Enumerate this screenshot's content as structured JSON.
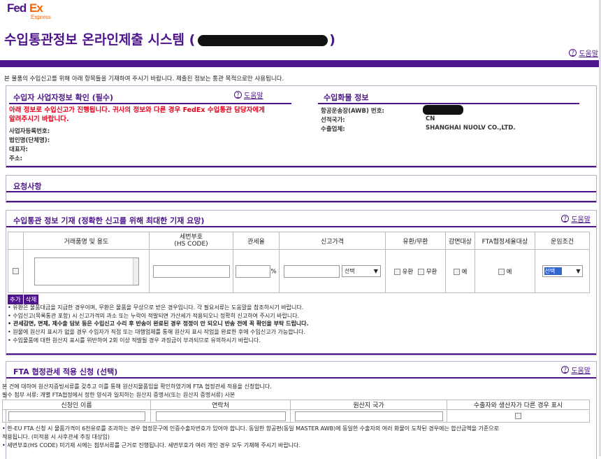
{
  "logo": {
    "fed": "Fed",
    "ex": "Ex",
    "express": "Express"
  },
  "title": {
    "main": "수입통관정보 온라인제출 시스템 (",
    "close": ")"
  },
  "help_label": "도움말",
  "intro": "본 물품의 수입신고를 위해 아래 항목들을 기재하여 주시기 바랍니다. 제출된 정보는 통관 목적으로만 사용됩니다.",
  "importer": {
    "title": "수입자 사업자정보 확인 (필수)",
    "warning": "아래 정보로 수입신고가 진행됩니다. 귀사의 정보와 다른 경우 FedEx 수입통관 담당자에게 알려주시기 바랍니다.",
    "fields": [
      "사업자등록번호:",
      "법인명(단체명):",
      "대표자:",
      "주소:"
    ]
  },
  "cargo": {
    "title": "수입화물 정보",
    "fields": [
      {
        "label": "항공운송장(AWB) 번호:",
        "value": ""
      },
      {
        "label": "선적국가:",
        "value": "CN"
      },
      {
        "label": "수출업체:",
        "value": "SHANGHAI NUOLV CO.,LTD."
      }
    ]
  },
  "requests": {
    "title": "요청사항"
  },
  "customs": {
    "title": "수입통관 정보 기재 (정확한 신고를 위해 최대한 기재 요망)",
    "headers": [
      "거래품명 및 용도",
      "세번부호\n(HS CODE)",
      "관세율",
      "신고가격",
      "유환/무환",
      "감면대상",
      "FTA협정세율대상",
      "운임조건"
    ],
    "percent": "%",
    "price_select": "선택",
    "paid_label": "유환",
    "free_label": "무환",
    "yes_label": "예",
    "freight_select": "선택",
    "add_label": "추가",
    "delete_label": "삭제",
    "notes": [
      "• 유환은 물품대금을 지급한 경우이며, 무환은 물품을 무상으로 받은 경우입니다. 각 필요서류는 도움말을 참조하시기 바랍니다.",
      "• 수입신고(목록통관 포함) 시 신고가격의 과소 또는 누락이 적발되면 가산세가 적용되오니 정확히 신고하여 주시기 바랍니다.",
      "• 관세감면, 면제, 제수출 담보 등은 수입신고 수리 후 반송이 완료된 경우 정정이 안 되오니 반송 전에 꼭 확인을 부탁 드립니다.",
      "• 원물에 원산지 표시가 없을 경우 수입자가 직접 또는 대행업체를 통해 원산지 표시 작업을 완료한 후에 수입신고가 가능합니다.",
      "• 수입물품에 대한 원산지 표시를 위반하여 2회 이상 적발될 경우 과징금이 부과되므로 유의하시기 바랍니다."
    ]
  },
  "fta": {
    "title": "FTA 협정관세 적용 신청 (선택)",
    "desc1": "본 건에 대하여 원산지증빙서류를 갖추고 이를 통해 원산지물품임을 확인하였기에 FTA 협정관세 적용을 신청합니다.",
    "desc2": "필수 첨부 서류: 개별 FTA협정에서 정한 양식과 일치하는 원산지 증명서(또는 원산지 증명서류) 사본",
    "headers": [
      "신청인 이름",
      "연락처",
      "원산지 국가",
      "수출자와 생산자가 다른 경우 표시"
    ],
    "notes": [
      "• 한-EU FTA 신청 시 물품가격이 6천유로를 초과하는 경우 협정문구에 인증수출자번호가 있어야 합니다. 동일한 항공편(동일 MASTER AWB)에 동일한 수출자의 여러 화물이 도착된 경우에는 합산금액을 기준으로",
      "적용됩니다. (미적용 시 사후관세 추징 대상임)",
      "• 세번부호(HS CODE) 미기재 시에는 첨부서류를 근거로 진행됩니다. 세번부호가 여러 개인 경우 모두 기재해 주시기 바랍니다."
    ]
  }
}
